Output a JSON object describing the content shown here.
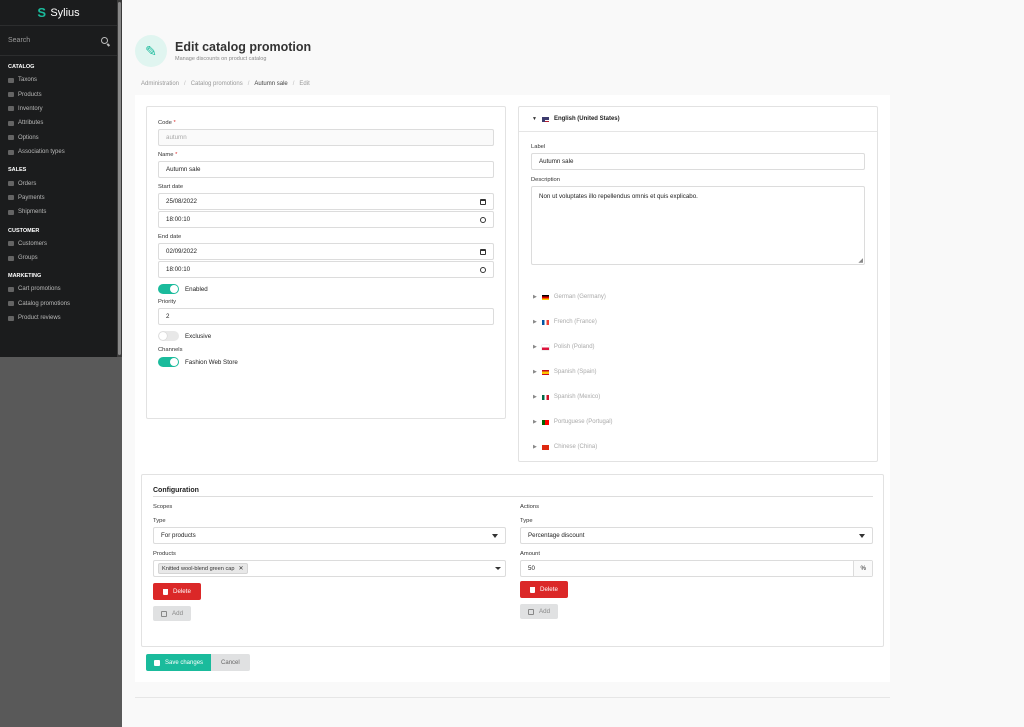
{
  "app": {
    "name": "Sylius"
  },
  "sidebar": {
    "search_label": "Search",
    "sections": [
      {
        "title": "CATALOG",
        "items": [
          "Taxons",
          "Products",
          "Inventory",
          "Attributes",
          "Options",
          "Association types"
        ]
      },
      {
        "title": "SALES",
        "items": [
          "Orders",
          "Payments",
          "Shipments"
        ]
      },
      {
        "title": "CUSTOMER",
        "items": [
          "Customers",
          "Groups"
        ]
      },
      {
        "title": "MARKETING",
        "items": [
          "Cart promotions",
          "Catalog promotions",
          "Product reviews"
        ]
      }
    ]
  },
  "header": {
    "title": "Edit catalog promotion",
    "subtitle": "Manage discounts on product catalog"
  },
  "breadcrumb": [
    "Administration",
    "Catalog promotions",
    "Autumn sale",
    "Edit"
  ],
  "form": {
    "code_label": "Code",
    "code_value": "autumn",
    "name_label": "Name",
    "name_value": "Autumn sale",
    "start_label": "Start date",
    "start_date": "25/08/2022",
    "start_time": "18:00:10",
    "end_label": "End date",
    "end_date": "02/09/2022",
    "end_time": "18:00:10",
    "enabled_label": "Enabled",
    "priority_label": "Priority",
    "priority_value": "2",
    "exclusive_label": "Exclusive",
    "channels_label": "Channels",
    "channel_name": "Fashion Web Store"
  },
  "translations": {
    "active": "English (United States)",
    "label_label": "Label",
    "label_value": "Autumn sale",
    "description_label": "Description",
    "description_value": "Non ut voluptates illo repellendus omnis et quis explicabo.",
    "others": [
      "German (Germany)",
      "French (France)",
      "Polish (Poland)",
      "Spanish (Spain)",
      "Spanish (Mexico)",
      "Portuguese (Portugal)",
      "Chinese (China)"
    ]
  },
  "config": {
    "title": "Configuration",
    "scopes": {
      "heading": "Scopes",
      "type_label": "Type",
      "type_value": "For products",
      "products_label": "Products",
      "product_chip": "Knitted wool-blend green cap",
      "delete": "Delete",
      "add": "Add"
    },
    "actions": {
      "heading": "Actions",
      "type_label": "Type",
      "type_value": "Percentage discount",
      "amount_label": "Amount",
      "amount_value": "50",
      "amount_unit": "%",
      "delete": "Delete",
      "add": "Add"
    }
  },
  "buttons": {
    "save": "Save changes",
    "cancel": "Cancel"
  }
}
